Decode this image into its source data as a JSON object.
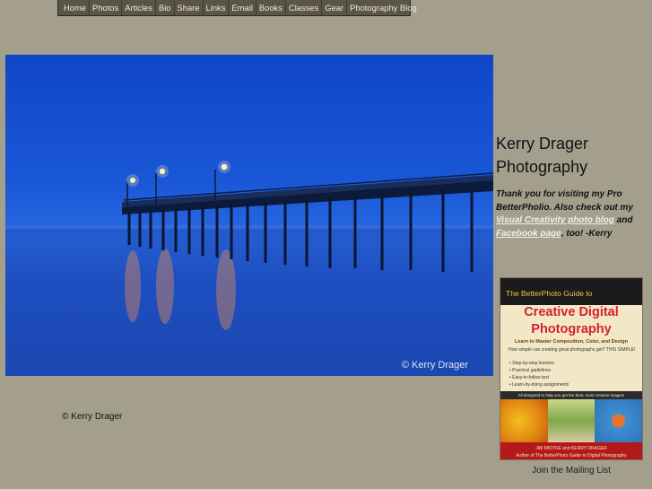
{
  "nav": {
    "items": [
      "Home",
      "Photos",
      "Articles",
      "Bio",
      "Share",
      "Links",
      "Email",
      "Books",
      "Classes",
      "Gear",
      "Photography Blog"
    ]
  },
  "photo": {
    "credit": "© Kerry Drager"
  },
  "sidebar": {
    "title_line1": "Kerry Drager",
    "title_line2": "Photography",
    "blurb_text1": "Thank you for visiting my Pro BetterPholio. Also check out my ",
    "blurb_link1": "Visual Creativity photo blog",
    "blurb_text2": " and ",
    "blurb_link2": "Facebook page",
    "blurb_text3": ", too! -Kerry"
  },
  "book": {
    "series": "The BetterPhoto Guide to",
    "title_line1": "Creative Digital",
    "title_line2": "Photography",
    "subtitle": "Learn to Master Composition, Color, and Design",
    "question": "How simple can creating great photographs get? THIS SIMPLE!",
    "bullets": [
      "Step-by-step lessons",
      "Practical guidelines",
      "Easy-to-follow text",
      "Learn-by-doing assignments"
    ],
    "bar_text": "All designed to help you get the best, most creative images!",
    "authors": "JIM MIOTKE and KERRY DRAGER",
    "authors_sub": "Author of The BetterPhoto Guide to Digital Photography"
  },
  "mailing_link": "Join the Mailing List",
  "footer": {
    "copyright": "© Kerry Drager"
  }
}
